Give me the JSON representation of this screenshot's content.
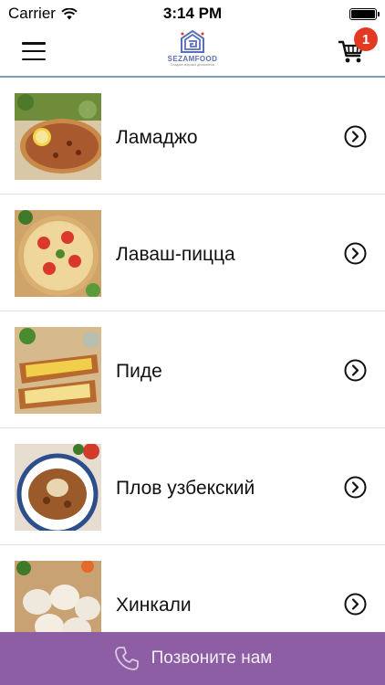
{
  "status_bar": {
    "carrier": "Carrier",
    "time": "3:14 PM",
    "battery_level": 1.0
  },
  "header": {
    "logo_text": "SEZAMFOOD",
    "logo_subtext": "Сладкие морские деликатесы",
    "cart_count": "1",
    "accent_color": "#7a9ec4",
    "badge_color": "#e23a22"
  },
  "menu": {
    "items": [
      {
        "label": "Ламаджо",
        "icon": "chevron-right-icon"
      },
      {
        "label": "Лаваш-пицца",
        "icon": "chevron-right-icon"
      },
      {
        "label": "Пиде",
        "icon": "chevron-right-icon"
      },
      {
        "label": "Плов узбекский",
        "icon": "chevron-right-icon"
      },
      {
        "label": "Хинкали",
        "icon": "chevron-right-icon"
      }
    ]
  },
  "call_bar": {
    "label": "Позвоните нам",
    "icon": "phone-icon",
    "background": "#8d5ea3"
  }
}
